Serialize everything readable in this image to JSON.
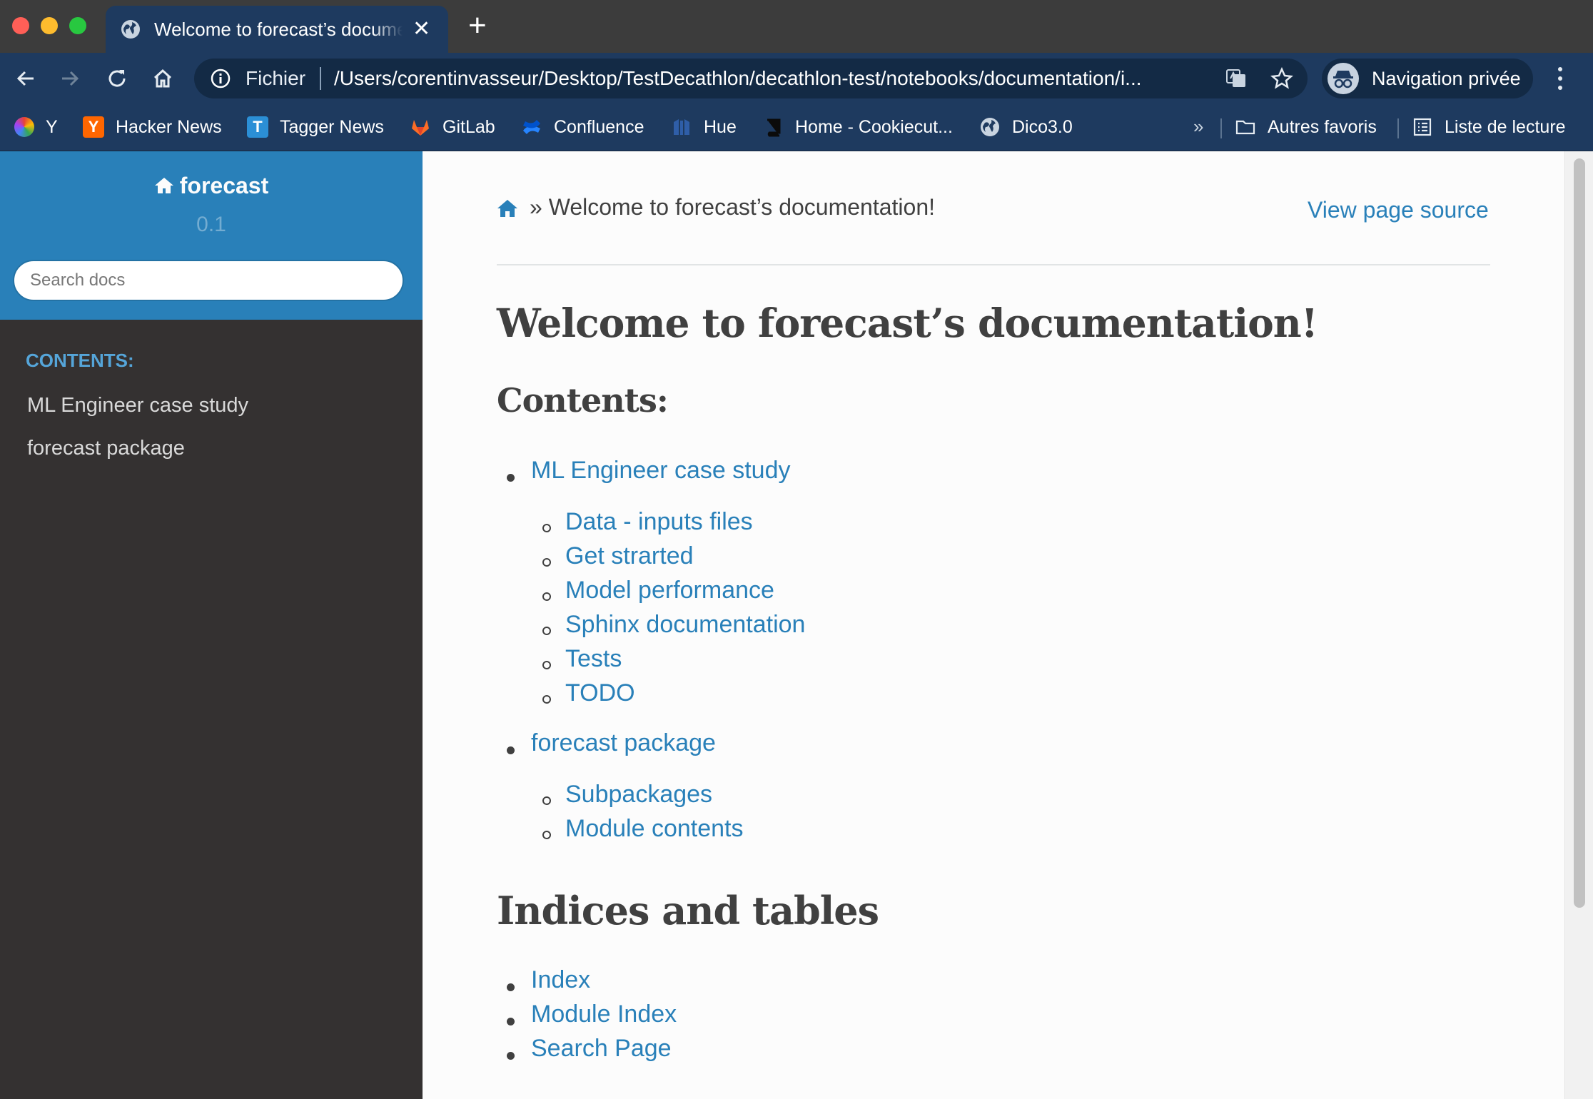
{
  "browser": {
    "tab_title": "Welcome to forecast’s documentation!",
    "tab_close": "✕",
    "new_tab": "+",
    "omnibox_scheme": "Fichier",
    "url": "/Users/corentinvasseur/Desktop/TestDecathlon/decathlon-test/notebooks/documentation/i...",
    "profile_label": "Navigation privée",
    "accent": "#1e3a5f"
  },
  "bookmarks": {
    "items": [
      {
        "label": "Y",
        "icon": "multicolor-logo-icon"
      },
      {
        "label": "Hacker News",
        "icon": "hacker-news-icon"
      },
      {
        "label": "Tagger News",
        "icon": "tagger-news-icon"
      },
      {
        "label": "GitLab",
        "icon": "gitlab-icon"
      },
      {
        "label": "Confluence",
        "icon": "confluence-icon"
      },
      {
        "label": "Hue",
        "icon": "hue-icon"
      },
      {
        "label": "Home - Cookiecut...",
        "icon": "book-icon"
      },
      {
        "label": "Dico3.0",
        "icon": "globe-icon"
      }
    ],
    "overflow": "»",
    "other_favorites": "Autres favoris",
    "reading_list": "Liste de lecture"
  },
  "sidebar": {
    "project": "forecast",
    "version": "0.1",
    "search_placeholder": "Search docs",
    "caption": "CONTENTS:",
    "items": [
      "ML Engineer case study",
      "forecast package"
    ]
  },
  "page": {
    "breadcrumb_sep": "»",
    "breadcrumb": "Welcome to forecast’s documentation!",
    "view_source": "View page source",
    "title": "Welcome to forecast’s documentation!",
    "contents_heading": "Contents:",
    "toc": [
      {
        "label": "ML Engineer case study",
        "children": [
          "Data - inputs files",
          "Get strarted",
          "Model performance",
          "Sphinx documentation",
          "Tests",
          "TODO"
        ]
      },
      {
        "label": "forecast package",
        "children": [
          "Subpackages",
          "Module contents"
        ]
      }
    ],
    "indices_heading": "Indices and tables",
    "indices": [
      "Index",
      "Module Index",
      "Search Page"
    ]
  }
}
